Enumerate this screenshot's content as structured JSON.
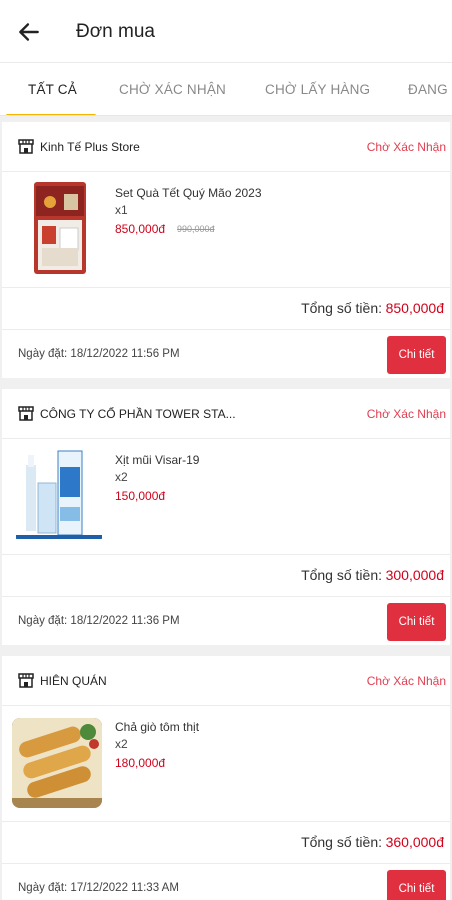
{
  "header": {
    "title": "Đơn mua",
    "back_icon": "arrow-left-icon"
  },
  "tabs": [
    {
      "label": "TẤT CẢ",
      "active": true
    },
    {
      "label": "CHỜ XÁC NHẬN",
      "active": false
    },
    {
      "label": "CHỜ LẤY HÀNG",
      "active": false
    },
    {
      "label": "ĐANG",
      "active": false
    }
  ],
  "colors": {
    "accent": "#f4b400",
    "price_red": "#d0021b",
    "button_red": "#e0303f",
    "status_red": "#e03e4f"
  },
  "orders": [
    {
      "shop_name": "Kinh Tế Plus Store",
      "status": "Chờ Xác Nhận",
      "item": {
        "name": "Set Quà Tết Quý Mão 2023",
        "qty": "x1",
        "price": "850,000đ",
        "old_price": "990,000đ"
      },
      "total_label": "Tổng số tiền:",
      "total_value": "850,000đ",
      "date": "Ngày đặt: 18/12/2022 11:56 PM",
      "detail_label": "Chi tiết"
    },
    {
      "shop_name": "CÔNG TY CỔ PHẦN TOWER STA...",
      "status": "Chờ Xác Nhận",
      "item": {
        "name": "Xịt mũi Visar-19",
        "qty": "x2",
        "price": "150,000đ"
      },
      "total_label": "Tổng số tiền:",
      "total_value": "300,000đ",
      "date": "Ngày đặt: 18/12/2022 11:36 PM",
      "detail_label": "Chi tiết"
    },
    {
      "shop_name": "HIÊN QUÁN",
      "status": "Chờ Xác Nhận",
      "item": {
        "name": "Chả giò tôm thịt",
        "qty": "x2",
        "price": "180,000đ"
      },
      "total_label": "Tổng số tiền:",
      "total_value": "360,000đ",
      "date": "Ngày đặt: 17/12/2022 11:33 AM",
      "detail_label": "Chi tiết"
    }
  ]
}
